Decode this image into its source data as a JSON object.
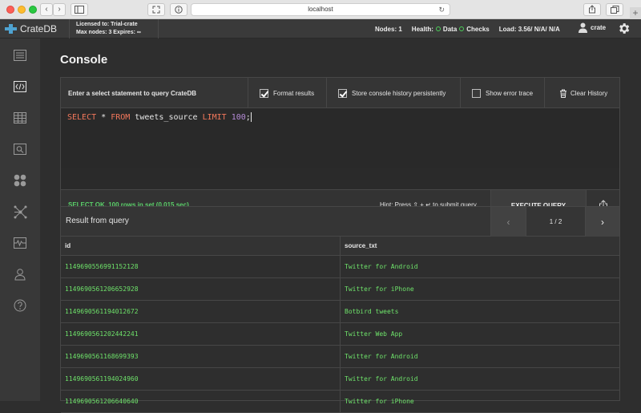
{
  "browser": {
    "url": "localhost"
  },
  "header": {
    "brand": "CrateDB",
    "license_line1": "Licensed to: Trial-crate",
    "license_line2": "Max nodes: 3 Expires: ∞",
    "nodes": "Nodes: 1",
    "health_label": "Health:",
    "health_data": "Data",
    "health_checks": "Checks",
    "load": "Load: 3.56/ N/A/ N/A",
    "user": "crate",
    "colors": {
      "ok": "#4ccf5a",
      "accent": "#4fa3d1"
    }
  },
  "sidebar": {
    "items": [
      {
        "icon": "list-icon"
      },
      {
        "icon": "console-icon",
        "active": true
      },
      {
        "icon": "table-icon"
      },
      {
        "icon": "search-view-icon"
      },
      {
        "icon": "shards-icon"
      },
      {
        "icon": "cluster-icon"
      },
      {
        "icon": "monitoring-icon"
      },
      {
        "icon": "users-icon"
      },
      {
        "icon": "help-icon"
      }
    ]
  },
  "page": {
    "title": "Console"
  },
  "console": {
    "prompt": "Enter a select statement to query CrateDB",
    "format_results": "Format results",
    "store_history": "Store console history persistently",
    "show_error_trace": "Show error trace",
    "clear_history": "Clear History",
    "query_kw1": "SELECT",
    "query_star": " * ",
    "query_kw2": "FROM",
    "query_table": " tweets_source ",
    "query_kw3": "LIMIT",
    "query_sp": " ",
    "query_num": "100",
    "query_end": ";",
    "status": "SELECT OK, 100 rows in set (0.015 sec)",
    "hint": "Hint: Press ⇧ + ↵ to submit query.",
    "execute": "EXECUTE QUERY"
  },
  "results": {
    "title": "Result from query",
    "page": "1 / 2",
    "columns": [
      "id",
      "source_txt"
    ],
    "rows": [
      [
        "1149690556991152128",
        "Twitter for Android"
      ],
      [
        "1149690561206652928",
        "Twitter for iPhone"
      ],
      [
        "1149690561194012672",
        "Botbird tweets"
      ],
      [
        "1149690561202442241",
        "Twitter Web App"
      ],
      [
        "1149690561168699393",
        "Twitter for Android"
      ],
      [
        "1149690561194024960",
        "Twitter for Android"
      ],
      [
        "1149690561206640640",
        "Twitter for iPhone"
      ]
    ]
  }
}
